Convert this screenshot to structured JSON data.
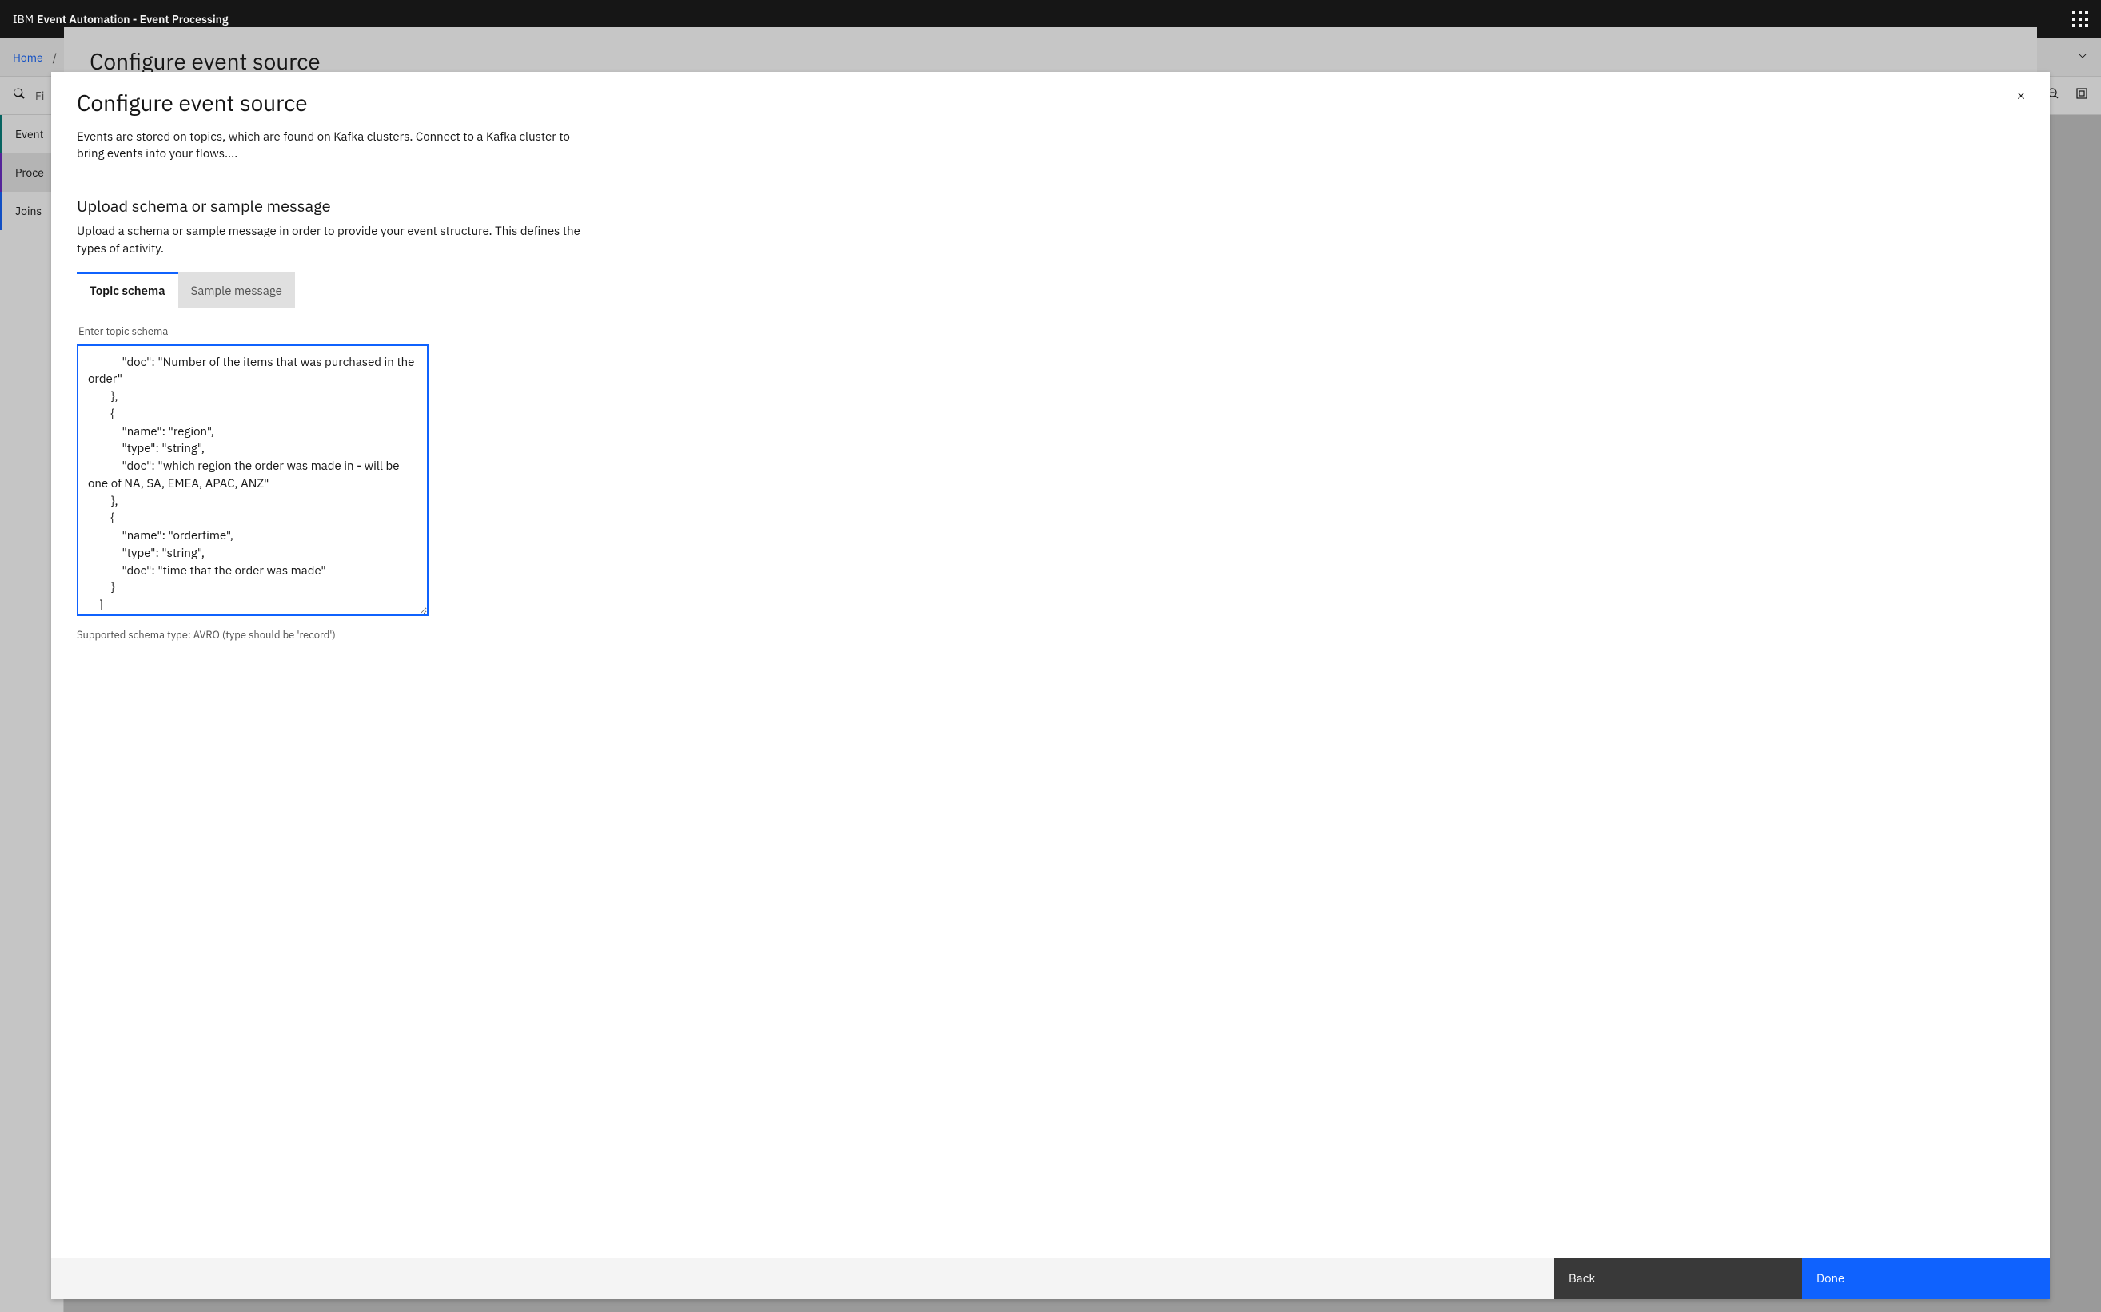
{
  "header": {
    "brand_prefix": "IBM",
    "brand_strong": "Event Automation - Event Processing"
  },
  "breadcrumb": {
    "home": "Home",
    "sep": "/"
  },
  "toolbar": {
    "filter_placeholder": "Fi"
  },
  "sidebar": {
    "items": [
      {
        "label": "Event"
      },
      {
        "label": "Proce"
      },
      {
        "label": "Joins"
      }
    ]
  },
  "bg_modal": {
    "title": "Configure event source"
  },
  "modal": {
    "title": "Configure event source",
    "description": "Events are stored on topics, which are found on Kafka clusters. Connect to a Kafka cluster to bring events into your flows....",
    "section_title": "Upload schema or sample message",
    "section_desc": "Upload a schema or sample message in order to provide your event structure. This defines the types of activity.",
    "tabs": {
      "topic_schema": "Topic schema",
      "sample_message": "Sample message"
    },
    "field_label": "Enter topic schema",
    "schema_value": "            \"doc\": \"Number of the items that was purchased in the order\"\n        },\n        {\n            \"name\": \"region\",\n            \"type\": \"string\",\n            \"doc\": \"which region the order was made in - will be one of NA, SA, EMEA, APAC, ANZ\"\n        },\n        {\n            \"name\": \"ordertime\",\n            \"type\": \"string\",\n            \"doc\": \"time that the order was made\"\n        }\n    ]\n}",
    "helper_text": "Supported schema type: AVRO (type should be 'record')",
    "back_label": "Back",
    "done_label": "Done"
  }
}
